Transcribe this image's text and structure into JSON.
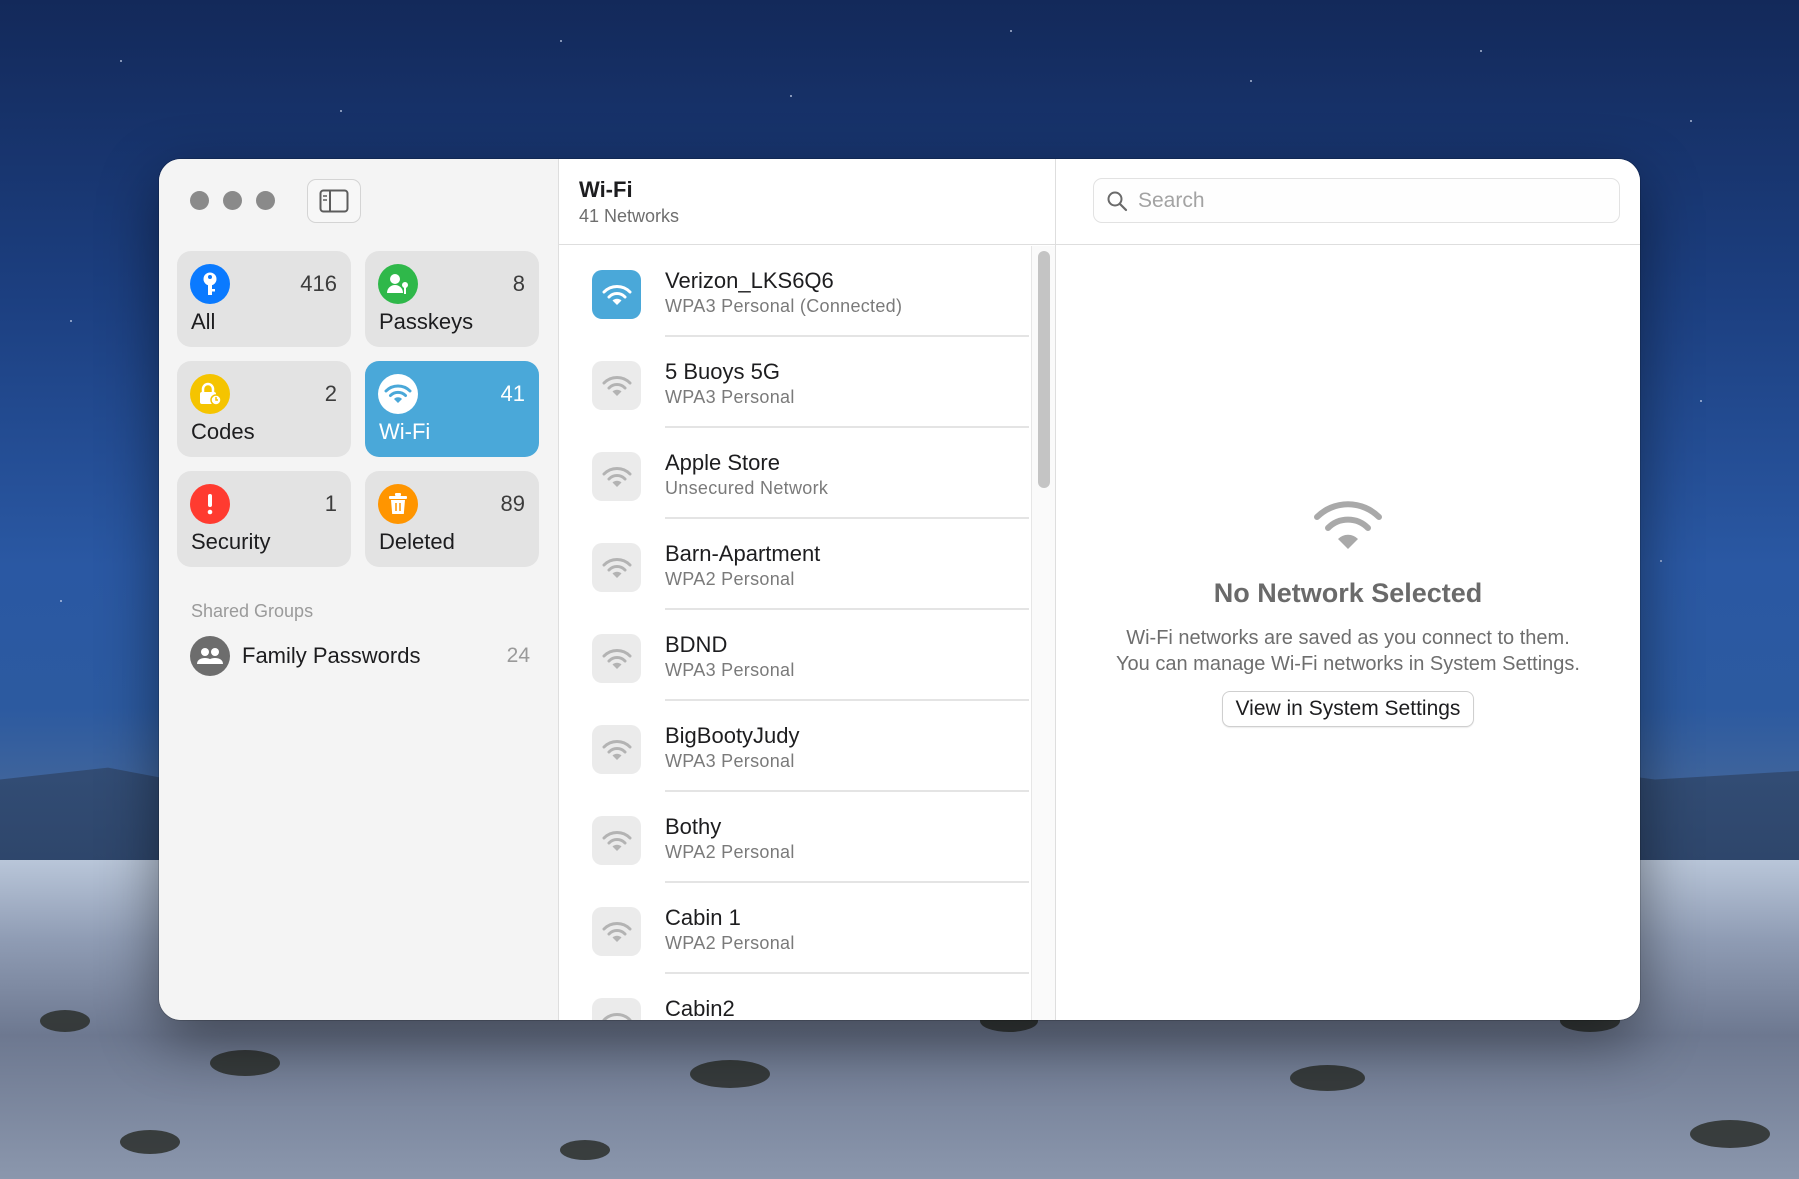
{
  "sidebar": {
    "tiles": [
      {
        "label": "All",
        "count": "416",
        "icon": "key-icon",
        "color": "#0a7aff"
      },
      {
        "label": "Passkeys",
        "count": "8",
        "icon": "person-key-icon",
        "color": "#2fb84a"
      },
      {
        "label": "Codes",
        "count": "2",
        "icon": "lock-clock-icon",
        "color": "#f5c400"
      },
      {
        "label": "Wi-Fi",
        "count": "41",
        "icon": "wifi-icon",
        "color": "#4aa8d9"
      },
      {
        "label": "Security",
        "count": "1",
        "icon": "exclamation-icon",
        "color": "#ff3b30"
      },
      {
        "label": "Deleted",
        "count": "89",
        "icon": "trash-icon",
        "color": "#ff9500"
      }
    ],
    "shared_groups_heading": "Shared Groups",
    "groups": [
      {
        "name": "Family Passwords",
        "count": "24"
      }
    ]
  },
  "list": {
    "title": "Wi-Fi",
    "subtitle": "41 Networks",
    "networks": [
      {
        "name": "Verizon_LKS6Q6",
        "security": "WPA3 Personal (Connected)",
        "connected": true
      },
      {
        "name": "5 Buoys 5G",
        "security": "WPA3 Personal",
        "connected": false
      },
      {
        "name": "Apple Store",
        "security": "Unsecured Network",
        "connected": false
      },
      {
        "name": "Barn-Apartment",
        "security": "WPA2 Personal",
        "connected": false
      },
      {
        "name": "BDND",
        "security": "WPA3 Personal",
        "connected": false
      },
      {
        "name": "BigBootyJudy",
        "security": "WPA3 Personal",
        "connected": false
      },
      {
        "name": "Bothy",
        "security": "WPA2 Personal",
        "connected": false
      },
      {
        "name": "Cabin 1",
        "security": "WPA2 Personal",
        "connected": false
      },
      {
        "name": "Cabin2",
        "security": "",
        "connected": false
      }
    ]
  },
  "detail": {
    "search_placeholder": "Search",
    "empty_title": "No Network Selected",
    "empty_line1": "Wi-Fi networks are saved as you connect to them.",
    "empty_line2": "You can manage Wi-Fi networks in System Settings.",
    "button_label": "View in System Settings"
  }
}
